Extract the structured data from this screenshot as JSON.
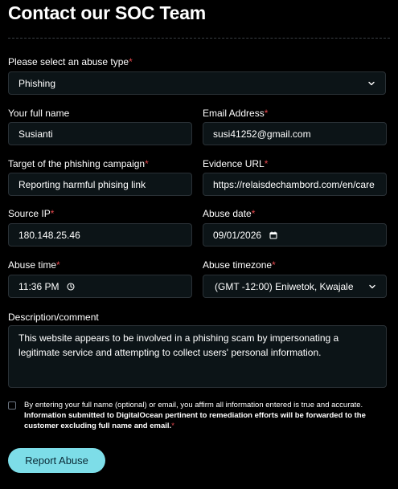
{
  "page": {
    "title": "Contact our SOC Team"
  },
  "form": {
    "abuse_type": {
      "label": "Please select an abuse type",
      "required_mark": "*",
      "value": "Phishing"
    },
    "full_name": {
      "label": "Your full name",
      "value": "Susianti"
    },
    "email": {
      "label": "Email Address",
      "required_mark": "*",
      "value": "susi41252@gmail.com"
    },
    "target": {
      "label": "Target of the phishing campaign",
      "required_mark": "*",
      "value": "Reporting harmful phising link"
    },
    "evidence_url": {
      "label": "Evidence URL",
      "required_mark": "*",
      "value": "https://relaisdechambord.com/en/care"
    },
    "source_ip": {
      "label": "Source IP",
      "required_mark": "*",
      "value": "180.148.25.46"
    },
    "abuse_date": {
      "label": "Abuse date",
      "required_mark": "*",
      "value": "09/01/2026"
    },
    "abuse_time": {
      "label": "Abuse time",
      "required_mark": "*",
      "value": "11:36 PM"
    },
    "abuse_timezone": {
      "label": "Abuse timezone",
      "required_mark": "*",
      "value": "(GMT -12:00) Eniwetok, Kwajale"
    },
    "description": {
      "label": "Description/comment",
      "value": "This website appears to be involved in a phishing scam by impersonating a legitimate service and attempting to collect users' personal information."
    },
    "consent": {
      "text_normal": "By entering your full name (optional) or email, you affirm all information entered is true and accurate. ",
      "text_bold": "Information submitted to DigitalOcean pertinent to remediation efforts will be forwarded to the customer excluding full name and email.",
      "required_mark": "*",
      "checked": false
    },
    "submit_label": "Report Abuse"
  },
  "colors": {
    "background": "#000000",
    "field_background": "#0c1417",
    "field_border": "#2a3136",
    "required": "#e5484d",
    "button": "#7ddde8",
    "button_text": "#0a2a36"
  },
  "icons": {
    "select": "chevron-down-icon",
    "date": "calendar-icon",
    "time": "clock-icon"
  }
}
